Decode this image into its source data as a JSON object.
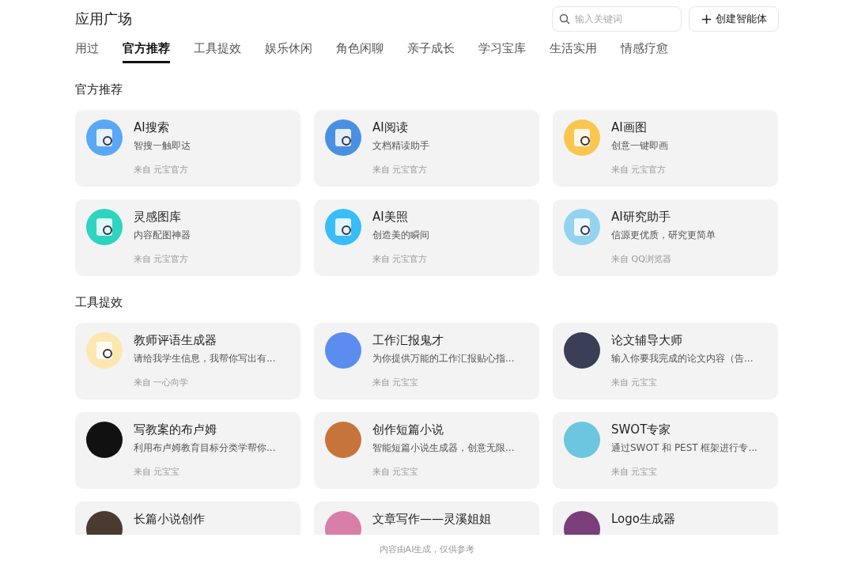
{
  "header": {
    "title": "应用广场",
    "search": {
      "placeholder": "输入关键词"
    },
    "create_button": {
      "icon": "+",
      "label": "创建智能体"
    }
  },
  "tabs": [
    {
      "label": "用过",
      "selected": false
    },
    {
      "label": "官方推荐",
      "selected": true
    },
    {
      "label": "工具提效",
      "selected": false
    },
    {
      "label": "娱乐休闲",
      "selected": false
    },
    {
      "label": "角色闲聊",
      "selected": false
    },
    {
      "label": "亲子成长",
      "selected": false
    },
    {
      "label": "学习宝库",
      "selected": false
    },
    {
      "label": "生活实用",
      "selected": false
    },
    {
      "label": "情感疗愈",
      "selected": false
    }
  ],
  "sections": [
    {
      "title": "官方推荐",
      "cards": [
        {
          "name": "AI搜索",
          "description": "智搜一触即达",
          "source": "来自 元宝官方"
        },
        {
          "name": "AI阅读",
          "description": "文档精读助手",
          "source": "来自 元宝官方"
        },
        {
          "name": "AI画图",
          "description": "创意一键即画",
          "source": "来自 元宝官方"
        },
        {
          "name": "灵感图库",
          "description": "内容配图神器",
          "source": "来自 元宝官方"
        },
        {
          "name": "AI美照",
          "description": "创造美的瞬间",
          "source": "来自 元宝官方"
        },
        {
          "name": "AI研究助手",
          "description": "信源更优质，研究更简单",
          "source": "来自 QQ浏览器"
        }
      ]
    },
    {
      "title": "工具提效",
      "cards": [
        {
          "name": "教师评语生成器",
          "description": "请给我学生信息，我帮你写出有...",
          "source": "来自 一心向学"
        },
        {
          "name": "工作汇报鬼才",
          "description": "为你提供万能的工作汇报贴心指...",
          "source": "来自 元宝宝"
        },
        {
          "name": "论文辅导大师",
          "description": "输入你要我完成的论文内容（告...",
          "source": "来自 元宝宝"
        },
        {
          "name": "写教案的布卢姆",
          "description": "利用布卢姆教育目标分类学帮你...",
          "source": "来自 元宝宝"
        },
        {
          "name": "创作短篇小说",
          "description": "智能短篇小说生成器，创意无限...",
          "source": "来自 元宝宝"
        },
        {
          "name": "SWOT专家",
          "description": "通过SWOT 和 PEST 框架进行专...",
          "source": "来自 元宝宝"
        },
        {
          "name": "长篇小说创作"
        },
        {
          "name": "文章写作——灵溪姐姐"
        },
        {
          "name": "Logo生成器"
        }
      ]
    }
  ],
  "footer": {
    "note": "内容由AI生成，仅供参考"
  }
}
